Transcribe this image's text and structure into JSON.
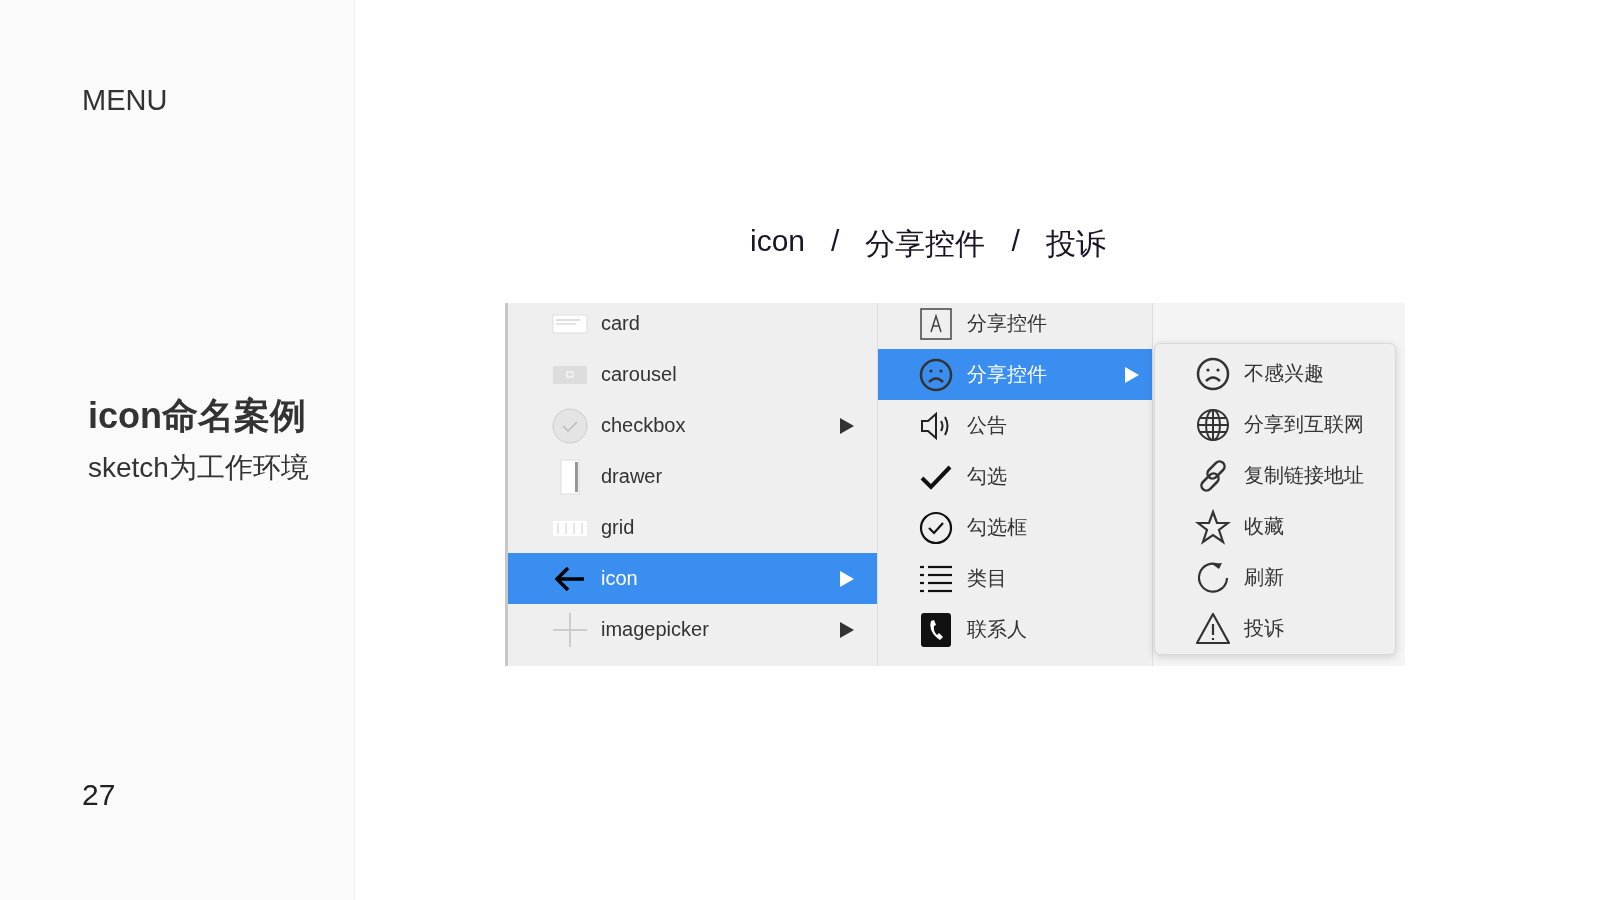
{
  "sidebar": {
    "menu_label": "MENU",
    "title": "icon命名案例",
    "subtitle": "sketch为工作环境",
    "page_number": "27"
  },
  "breadcrumb": [
    {
      "kind": "part",
      "text": "icon"
    },
    {
      "kind": "separator",
      "text": "/"
    },
    {
      "kind": "part",
      "text": "分享控件"
    },
    {
      "kind": "separator",
      "text": "/"
    },
    {
      "kind": "part",
      "text": "投诉"
    }
  ],
  "component_menu": [
    {
      "label": "card",
      "kind": "card",
      "has_submenu": false,
      "selected": false
    },
    {
      "label": "carousel",
      "kind": "carousel",
      "has_submenu": false,
      "selected": false
    },
    {
      "label": "checkbox",
      "kind": "checkbox",
      "has_submenu": true,
      "selected": false
    },
    {
      "label": "drawer",
      "kind": "drawer",
      "has_submenu": false,
      "selected": false
    },
    {
      "label": "grid",
      "kind": "grid",
      "has_submenu": false,
      "selected": false
    },
    {
      "label": "icon",
      "kind": "arrow",
      "has_submenu": true,
      "selected": true
    },
    {
      "label": "imagepicker",
      "kind": "plus",
      "has_submenu": true,
      "selected": false
    }
  ],
  "icon_menu": [
    {
      "label": "分享控件",
      "kind": "frame",
      "has_submenu": false,
      "selected": false
    },
    {
      "label": "分享控件",
      "kind": "sad",
      "has_submenu": true,
      "selected": true
    },
    {
      "label": "公告",
      "kind": "speaker",
      "has_submenu": false,
      "selected": false
    },
    {
      "label": "勾选",
      "kind": "check",
      "has_submenu": false,
      "selected": false
    },
    {
      "label": "勾选框",
      "kind": "check-circle",
      "has_submenu": false,
      "selected": false
    },
    {
      "label": "类目",
      "kind": "list",
      "has_submenu": false,
      "selected": false
    },
    {
      "label": "联系人",
      "kind": "phone",
      "has_submenu": false,
      "selected": false
    }
  ],
  "share_menu": [
    {
      "label": "不感兴趣",
      "kind": "sad",
      "selected": false
    },
    {
      "label": "分享到互联网",
      "kind": "globe",
      "selected": false
    },
    {
      "label": "复制链接地址",
      "kind": "link",
      "selected": false
    },
    {
      "label": "收藏",
      "kind": "star",
      "selected": false
    },
    {
      "label": "刷新",
      "kind": "refresh",
      "selected": false
    },
    {
      "label": "投诉",
      "kind": "warning",
      "selected": false
    }
  ]
}
